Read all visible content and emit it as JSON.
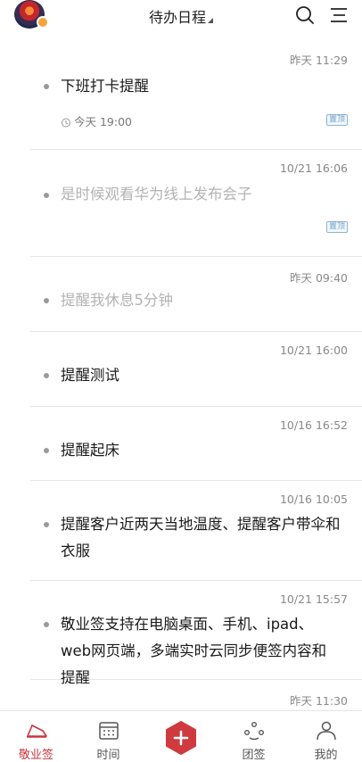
{
  "header": {
    "title": "待办日程",
    "avatar": "avatar",
    "icons": {
      "search": "search-icon",
      "menu": "menu-icon"
    }
  },
  "items": [
    {
      "time": "昨天  11:29",
      "text": "下班打卡提醒",
      "done": false,
      "reminder": "今天 19:00",
      "pinned": true,
      "pin_label": "置顶"
    },
    {
      "time": "10/21 16:06",
      "text": "是时候观看华为线上发布会子",
      "done": true,
      "pinned": true,
      "pin_label": "置顶"
    },
    {
      "time": "昨天  09:40",
      "text": "提醒我休息5分钟",
      "done": true
    },
    {
      "time": "10/21 16:00",
      "text": "提醒测试",
      "done": false
    },
    {
      "time": "10/16 16:52",
      "text": "提醒起床",
      "done": false
    },
    {
      "time": "10/16 10:05",
      "text": "提醒客户近两天当地温度、提醒客户带伞和衣服",
      "done": false
    },
    {
      "time": "10/21 15:57",
      "text": "敬业签支持在电脑桌面、手机、ipad、web网页端，多端实时云同步便签内容和提醒",
      "done": false
    },
    {
      "time": "昨天  11:30",
      "text": "",
      "done": false
    }
  ],
  "tabs": [
    {
      "label": "敬业签",
      "icon": "note-icon",
      "active": true
    },
    {
      "label": "时间",
      "icon": "calendar-icon",
      "active": false
    },
    {
      "label": "",
      "icon": "add-icon",
      "active": false
    },
    {
      "label": "团签",
      "icon": "team-icon",
      "active": false
    },
    {
      "label": "我的",
      "icon": "profile-icon",
      "active": false
    }
  ],
  "colors": {
    "accent": "#c9353b",
    "pin": "#6f9fc8",
    "done_text": "#b3b3b3"
  }
}
